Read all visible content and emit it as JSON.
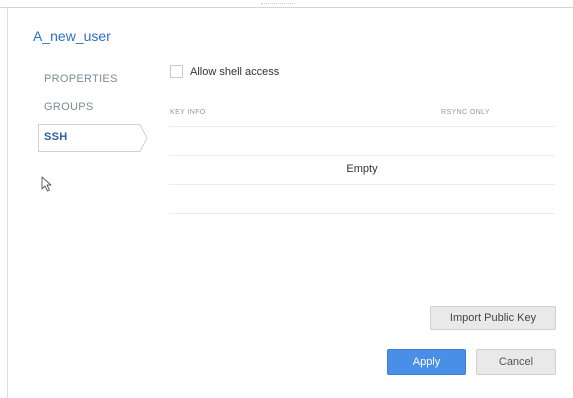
{
  "user": {
    "title": "A_new_user"
  },
  "sidebar": {
    "items": [
      {
        "label": "PROPERTIES"
      },
      {
        "label": "GROUPS"
      },
      {
        "label": "SSH"
      }
    ],
    "active": "SSH"
  },
  "ssh": {
    "shell_access_label": "Allow shell access",
    "shell_access_checked": false,
    "columns": [
      "KEY INFO",
      "RSYNC ONLY"
    ],
    "empty_text": "Empty"
  },
  "buttons": {
    "import_label": "Import Public Key",
    "apply_label": "Apply",
    "cancel_label": "Cancel"
  },
  "colors": {
    "accent": "#2d6fc4",
    "apply_bg": "#4a8fe7"
  }
}
